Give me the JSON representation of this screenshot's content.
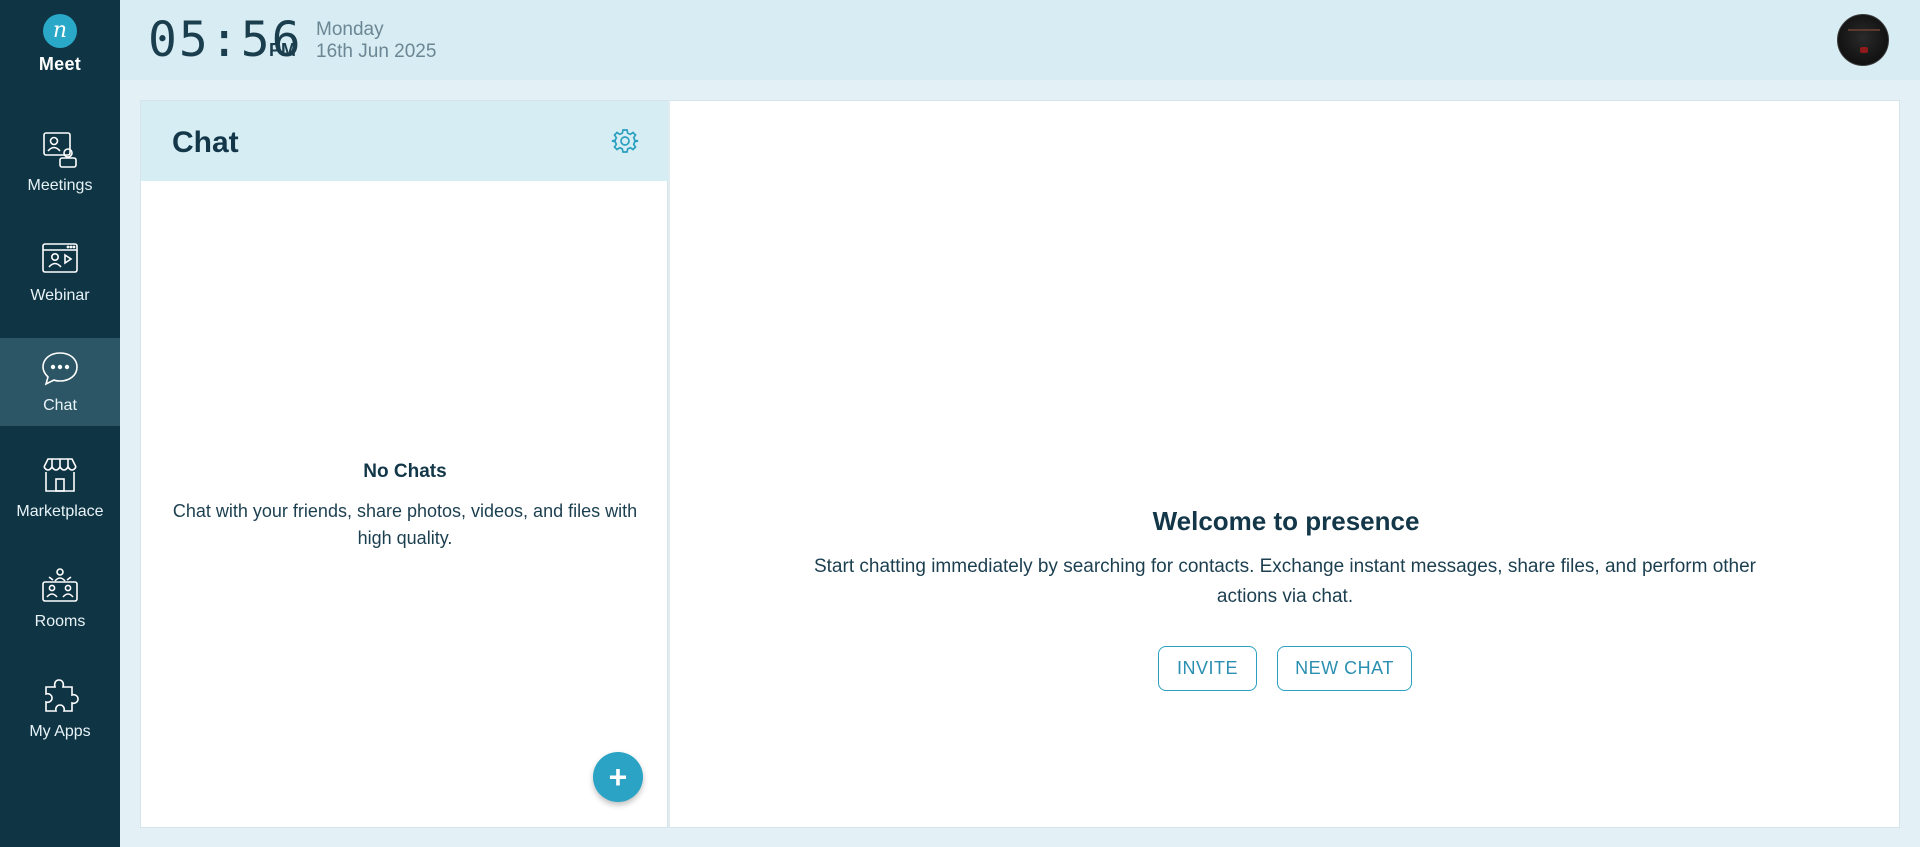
{
  "brand": {
    "logo_glyph": "n",
    "name": "Meet"
  },
  "sidebar": {
    "items": [
      {
        "label": "Meetings",
        "icon": "meetings-icon",
        "active": false
      },
      {
        "label": "Webinar",
        "icon": "webinar-icon",
        "active": false
      },
      {
        "label": "Chat",
        "icon": "chat-icon",
        "active": true
      },
      {
        "label": "Marketplace",
        "icon": "marketplace-icon",
        "active": false
      },
      {
        "label": "Rooms",
        "icon": "rooms-icon",
        "active": false
      },
      {
        "label": "My Apps",
        "icon": "puzzle-icon",
        "active": false
      }
    ]
  },
  "header": {
    "time": "05:56",
    "ampm": "PM",
    "day": "Monday",
    "date": "16th Jun 2025"
  },
  "chat_panel": {
    "title": "Chat",
    "empty_title": "No Chats",
    "empty_description": "Chat with your friends, share photos, videos, and files with high quality.",
    "fab_label": "+"
  },
  "main": {
    "welcome_title": "Welcome to presence",
    "welcome_description": "Start chatting immediately by searching for contacts. Exchange instant messages, share files, and perform other actions via chat.",
    "invite_label": "INVITE",
    "new_chat_label": "NEW CHAT"
  },
  "colors": {
    "sidebar_bg": "#0f3444",
    "sidebar_active": "#2c5565",
    "accent": "#2aa3c4",
    "header_bg": "#d8ecf3"
  }
}
